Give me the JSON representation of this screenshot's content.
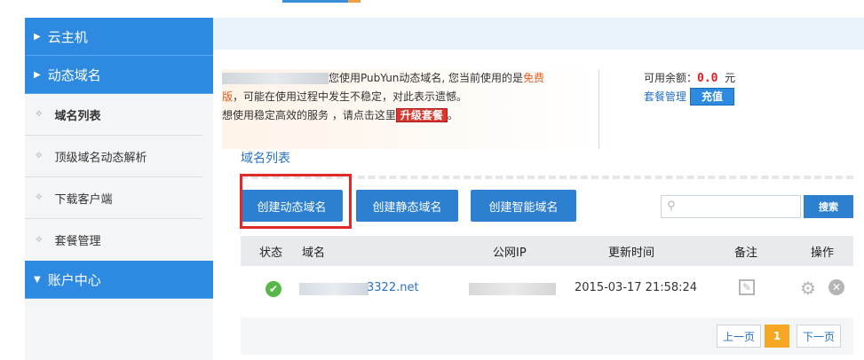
{
  "sidebar": {
    "sections": [
      {
        "label": "云主机"
      },
      {
        "label": "动态域名"
      }
    ],
    "items": [
      {
        "label": "域名列表"
      },
      {
        "label": "顶级域名动态解析"
      },
      {
        "label": "下载客户端"
      },
      {
        "label": "套餐管理"
      }
    ],
    "account": {
      "label": "账户中心"
    }
  },
  "notice": {
    "line1": "您使用PubYun动态域名, 您当前使用的是",
    "free": "免费",
    "line1b": "版",
    "line2": "，可能在使用过程中发生不稳定，对此表示遗憾。",
    "line3": "想使用稳定高效的服务 ，请点击这里",
    "upgrade": "升级套餐",
    "tail": "。"
  },
  "balance": {
    "label": "可用余额：",
    "amount": "0.0",
    "unit": "元",
    "plan_link": "套餐管理",
    "recharge": "充值"
  },
  "section_title": "域名列表",
  "buttons": {
    "create_dynamic": "创建动态域名",
    "create_static": "创建静态域名",
    "create_smart": "创建智能域名"
  },
  "search": {
    "placeholder": "",
    "button": "搜索"
  },
  "table": {
    "headers": [
      "状态",
      "域名",
      "公网IP",
      "更新时间",
      "备注",
      "操作"
    ],
    "rows": [
      {
        "domain_suffix": "3322.net",
        "updated": "2015-03-17 21:58:24"
      }
    ]
  },
  "pager": {
    "prev": "上一页",
    "current": "1",
    "next": "下一页"
  },
  "colors": {
    "accent": "#2e8ae0",
    "highlight_box": "#e02a2a",
    "status_ok": "#55b848",
    "pager_current": "#f5a623"
  }
}
